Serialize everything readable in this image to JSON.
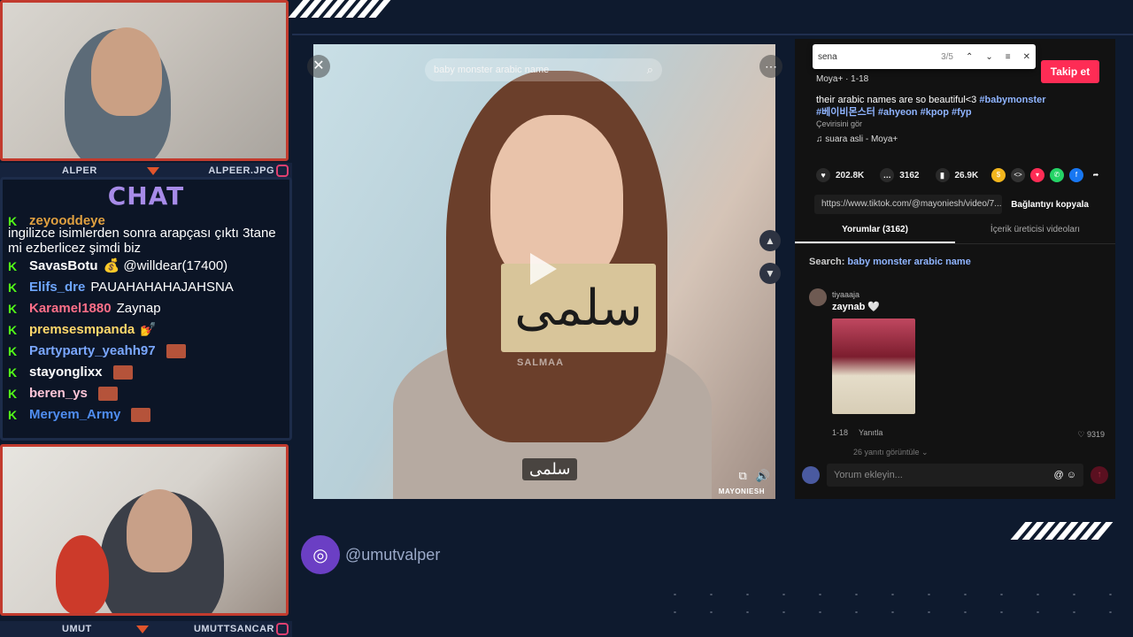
{
  "webcams": {
    "top": {
      "left_name": "ALPER",
      "right_name": "ALPEER.JPG"
    },
    "bottom": {
      "left_name": "UMUT",
      "right_name": "UMUTTSANCAR"
    }
  },
  "chat": {
    "title": "CHAT",
    "first_message": {
      "user": "zeyooddeye",
      "text": "ingilizce isimlerden sonra arapçası çıktı 3tane mi ezberlicez şimdi biz",
      "color": "#e0a040"
    },
    "messages": [
      {
        "user": "SavasBotu",
        "text": "💰 @willdear(17400)",
        "color": "#ffffff"
      },
      {
        "user": "Elifs_dre",
        "text": "PAUAHAHAHAJAHSNA",
        "color": "#6ea6ff"
      },
      {
        "user": "Karamel1880",
        "text": "Zaynap",
        "color": "#ff6f88"
      },
      {
        "user": "premsesmpanda",
        "text": "💅",
        "color": "#ffd86b"
      },
      {
        "user": "Partyparty_yeahh97",
        "text": "",
        "color": "#7aa7ff"
      },
      {
        "user": "stayonglixx",
        "text": "",
        "color": "#ffffff"
      },
      {
        "user": "beren_ys",
        "text": "",
        "color": "#ffc6d8"
      },
      {
        "user": "Meryem_Army",
        "text": "",
        "color": "#4f8df0"
      }
    ]
  },
  "video": {
    "search_placeholder": "baby monster arabic name",
    "card_text": "سلمى",
    "watermark": "SALMAA",
    "subtitle": "سلمى",
    "brand": "MAYONIESH"
  },
  "sidebar": {
    "find": {
      "query": "sena",
      "count": "3/5"
    },
    "follow_label": "Takip et",
    "author_line": "Moya+ · 1-18",
    "caption_text": "their arabic names are so beautiful<3 ",
    "caption_tags_1": "#babymonster",
    "caption_tags_2": "#베이비몬스터 #ahyeon #kpop #fyp",
    "translate_label": "Çevirisini gör",
    "sound": "suara asli - Moya+",
    "likes": "202.8K",
    "comments": "3162",
    "saves": "26.9K",
    "link": "https://www.tiktok.com/@mayoniesh/video/7...",
    "copy_label": "Bağlantıyı kopyala",
    "tab_comments": "Yorumlar (3162)",
    "tab_creator": "İçerik üreticisi videoları",
    "search_prefix": "Search: ",
    "search_query": "baby monster arabic name",
    "comment": {
      "user": "tiyaaaja",
      "text": "zaynab 🤍",
      "date": "1-18",
      "reply": "Yanıtla",
      "likes": "9319",
      "more": "26 yanıtı görüntüle ⌄"
    },
    "comment_placeholder": "Yorum ekleyin..."
  },
  "social": {
    "handle": "@umutvalper"
  },
  "colors": {
    "accent": "#fe2c55",
    "kick_green": "#53fc18",
    "frame_red": "#c23b2e"
  }
}
